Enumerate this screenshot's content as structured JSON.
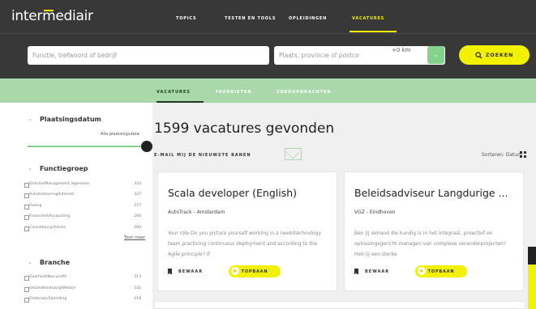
{
  "header": {
    "logo": "intermediair",
    "nav": [
      {
        "label": "TOPICS",
        "active": false
      },
      {
        "label": "TESTEN EN TOOLS",
        "active": false
      },
      {
        "label": "OPLEIDINGEN",
        "active": false
      },
      {
        "label": "VACATURES",
        "active": true
      }
    ]
  },
  "search": {
    "keyword_placeholder": "Functie, trefwoord of bedrijf",
    "location_placeholder": "Plaats, provincie of postco",
    "radius": "+0 km",
    "radius_icon": "chevron-down-icon",
    "submit_label": "ZOEKEN",
    "submit_icon": "search-icon"
  },
  "tabs": [
    {
      "label": "VACATURES",
      "active": true
    },
    {
      "label": "FAVORIETEN",
      "active": false
    },
    {
      "label": "ZOEKOPDRACHTEN",
      "active": false
    }
  ],
  "sidebar": {
    "plaatsingsdatum": {
      "title": "Plaatsingsdatum",
      "value_label": "Alle plaatsingsdata",
      "level": 1.0
    },
    "functiegroep": {
      "title": "Functiegroep",
      "options": [
        {
          "label": "Directie/Management algemeen",
          "count": "333"
        },
        {
          "label": "Automatisering/Internet",
          "count": "327"
        },
        {
          "label": "Overig",
          "count": "277"
        },
        {
          "label": "Financieel/Accounting",
          "count": "260"
        },
        {
          "label": "Consultancy/Advies",
          "count": "200"
        }
      ],
      "more_label": "Toon meer"
    },
    "branche": {
      "title": "Branche",
      "options": [
        {
          "label": "Overheid/Non-profit",
          "count": "313"
        },
        {
          "label": "Gezondheidszorg/Welzijn",
          "count": "232"
        },
        {
          "label": "Onderwijs/Opleiding",
          "count": "219"
        }
      ]
    }
  },
  "results": {
    "title": "1599 vacatures gevonden",
    "email_alert_label": "E-MAIL MIJ DE NIEUWSTE BANEN",
    "sort_label": "Sorteren: Datum"
  },
  "cards": [
    {
      "title": "Scala developer (English)",
      "company": "AutoTrack - Amsterdam",
      "description": "Your role Do you picture yourself working in a (web)technology team practicing continuous deployment and according to the Agile principle? If",
      "save_label": "BEWAAR",
      "badge_label": "TOPBAAN"
    },
    {
      "title": "Beleidsadviseur Langdurige ...",
      "company": "VGZ - Eindhoven",
      "description": "Ben jij iemand die kundig is in het integraal, proactief en oplossingsgericht managen van complexe veranderprojecten? Heb jij een sterke",
      "save_label": "BEWAAR",
      "badge_label": "TOPBAAN"
    }
  ],
  "colors": {
    "accent_yellow": "#f2f200",
    "accent_green": "#a9d9ab",
    "header_bg": "#383838"
  }
}
